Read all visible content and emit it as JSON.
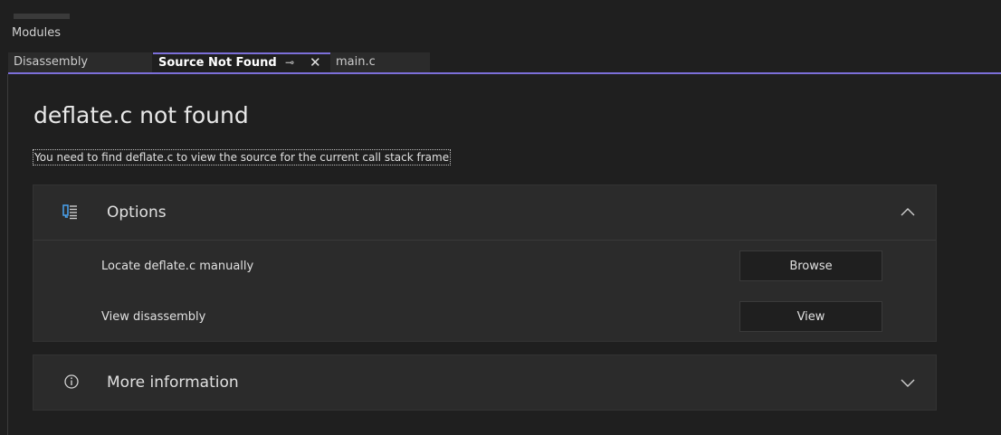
{
  "header": {
    "panel_label": "Modules"
  },
  "tabs": [
    {
      "label": "Disassembly",
      "active": false
    },
    {
      "label": "Source Not Found",
      "active": true,
      "pin_glyph": "⊸",
      "close_glyph": "✕"
    },
    {
      "label": "main.c",
      "active": false
    }
  ],
  "main": {
    "title": "deflate.c not found",
    "subtitle": "You need to find deflate.c to view the source for the current call stack frame"
  },
  "options_panel": {
    "title": "Options",
    "icon": "options-list-icon",
    "expanded": true,
    "rows": [
      {
        "label": "Locate deflate.c manually",
        "button": "Browse"
      },
      {
        "label": "View disassembly",
        "button": "View"
      }
    ]
  },
  "more_info_panel": {
    "title": "More information",
    "icon": "info-icon",
    "expanded": false
  },
  "colors": {
    "accent": "#7c6fd9",
    "background": "#1f1f1f",
    "panel": "#2b2b2b",
    "icon_blue": "#4aa3f0"
  }
}
